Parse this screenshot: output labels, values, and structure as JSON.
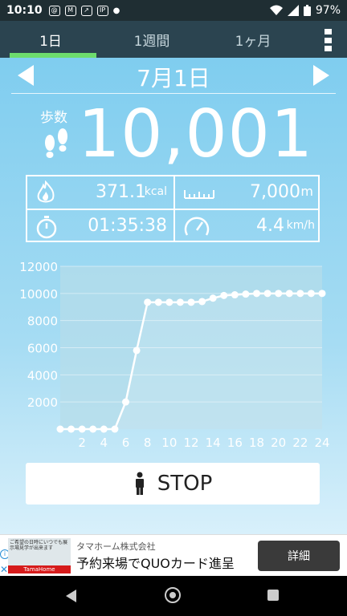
{
  "status_bar": {
    "time": "10:10",
    "battery": "97%",
    "notification_icons": [
      "at-sign-icon",
      "gmail-icon",
      "share-icon",
      "ip-icon"
    ]
  },
  "tabs": [
    {
      "label": "1日",
      "active": true
    },
    {
      "label": "1週間",
      "active": false
    },
    {
      "label": "1ヶ月",
      "active": false
    }
  ],
  "date": {
    "title": "7月1日"
  },
  "steps": {
    "label": "歩数",
    "value": "10,001"
  },
  "stats": {
    "calories": {
      "value": "371.1",
      "unit": "kcal"
    },
    "distance": {
      "value": "7,000",
      "unit": "m"
    },
    "duration": {
      "value": "01:35:38"
    },
    "speed": {
      "value": "4.4",
      "unit": "km/h"
    }
  },
  "chart_data": {
    "type": "line",
    "x": [
      0,
      1,
      2,
      3,
      4,
      5,
      6,
      7,
      8,
      9,
      10,
      11,
      12,
      13,
      14,
      15,
      16,
      17,
      18,
      19,
      20,
      21,
      22,
      23,
      24
    ],
    "values": [
      0,
      0,
      0,
      0,
      0,
      0,
      2000,
      5800,
      9350,
      9350,
      9350,
      9350,
      9350,
      9400,
      9650,
      9850,
      9900,
      9950,
      10000,
      10000,
      10000,
      10000,
      10001,
      10001,
      10001
    ],
    "xticks": [
      "2",
      "4",
      "6",
      "8",
      "10",
      "12",
      "14",
      "16",
      "18",
      "20",
      "22",
      "24"
    ],
    "yticks": [
      "2000",
      "4000",
      "6000",
      "8000",
      "10000",
      "12000"
    ],
    "ylim": [
      0,
      12000
    ],
    "xlim": [
      0,
      24
    ],
    "grid": true
  },
  "stop_button": {
    "label": "STOP"
  },
  "ad": {
    "image_text_top": "ご希望の日時にいつでも展示場見学が出来ます",
    "image_text_bottom": "TamaHome",
    "company": "タマホーム株式会社",
    "headline": "予約来場でQUOカード進呈",
    "button": "詳細"
  },
  "colors": {
    "tab_bar": "#2b4450",
    "tab_indicator": "#6ddc6d",
    "sky_top": "#7fcdef",
    "line": "#ffffff"
  }
}
